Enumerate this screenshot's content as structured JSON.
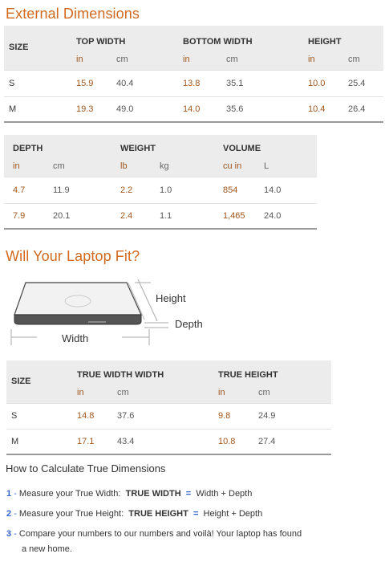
{
  "external": {
    "title": "External Dimensions",
    "table1": {
      "size_header": "SIZE",
      "groups": [
        "TOP WIDTH",
        "BOTTOM WIDTH",
        "HEIGHT"
      ],
      "units": [
        "in",
        "cm",
        "in",
        "cm",
        "in",
        "cm"
      ],
      "rows": [
        {
          "size": "S",
          "values": [
            "15.9",
            "40.4",
            "13.8",
            "35.1",
            "10.0",
            "25.4"
          ]
        },
        {
          "size": "M",
          "values": [
            "19.3",
            "49.0",
            "14.0",
            "35.6",
            "10.4",
            "26.4"
          ]
        }
      ]
    },
    "table2": {
      "groups": [
        "DEPTH",
        "WEIGHT",
        "VOLUME"
      ],
      "units": [
        "in",
        "cm",
        "lb",
        "kg",
        "cu in",
        "L"
      ],
      "rows": [
        {
          "values": [
            "4.7",
            "11.9",
            "2.2",
            "1.0",
            "854",
            "14.0"
          ]
        },
        {
          "values": [
            "7.9",
            "20.1",
            "2.4",
            "1.1",
            "1,465",
            "24.0"
          ]
        }
      ]
    }
  },
  "fit": {
    "title": "Will Your Laptop Fit?",
    "diagram": {
      "height": "Height",
      "depth": "Depth",
      "width": "Width"
    },
    "table": {
      "size_header": "SIZE",
      "groups": [
        "TRUE WIDTH WIDTH",
        "TRUE HEIGHT"
      ],
      "units": [
        "in",
        "cm",
        "in",
        "cm"
      ],
      "rows": [
        {
          "size": "S",
          "values": [
            "14.8",
            "37.6",
            "9.8",
            "24.9"
          ]
        },
        {
          "size": "M",
          "values": [
            "17.1",
            "43.4",
            "10.8",
            "27.4"
          ]
        }
      ]
    }
  },
  "howto": {
    "title": "How to Calculate True Dimensions",
    "steps": [
      {
        "num": "1",
        "text": "Measure your True Width:",
        "term": "TRUE WIDTH",
        "eq": "=",
        "formula": "Width + Depth"
      },
      {
        "num": "2",
        "text": "Measure your True Height:",
        "term": "TRUE HEIGHT",
        "eq": "=",
        "formula": "Height + Depth"
      },
      {
        "num": "3",
        "text": "Compare your numbers to our numbers and voilà! Your laptop has found",
        "text2": "a new home."
      }
    ]
  }
}
